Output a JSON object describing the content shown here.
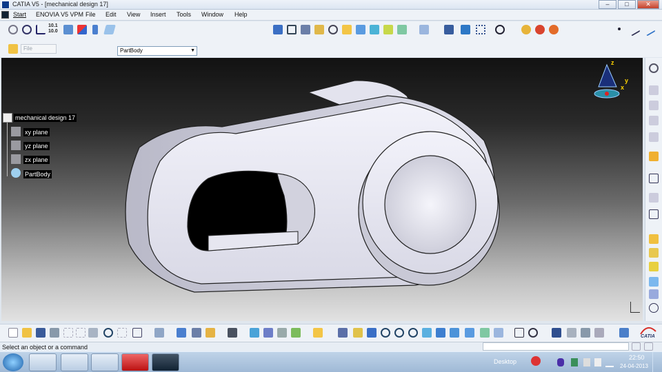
{
  "window": {
    "title": "CATIA V5 - [mechanical design 17]"
  },
  "window_controls": {
    "minimize": "–",
    "maximize": "□",
    "close": "✕"
  },
  "menu": {
    "items": [
      "Start",
      "ENOVIA V5 VPM",
      "File",
      "Edit",
      "View",
      "Insert",
      "Tools",
      "Window",
      "Help"
    ]
  },
  "toolbar": {
    "coord_top": "10.1",
    "coord_bottom": "10.0",
    "partbody_select": "PartBody",
    "file_select": "File"
  },
  "tree": {
    "root": "mechanical design 17",
    "items": [
      "xy plane",
      "yz plane",
      "zx plane",
      "PartBody"
    ]
  },
  "compass": {
    "z": "z",
    "y": "y",
    "x": "x"
  },
  "status": {
    "message": "Select an object or a command"
  },
  "catia_logo": "CATIA",
  "taskbar": {
    "desktop": "Desktop",
    "time": "22:50",
    "date": "24-04-2013"
  },
  "colors": {
    "viewport_top": "#121212",
    "viewport_bottom": "#e2e2e2",
    "part_face": "#e9e9f3",
    "part_shade": "#b8b8c6",
    "tree_label_bg": "#000000"
  }
}
